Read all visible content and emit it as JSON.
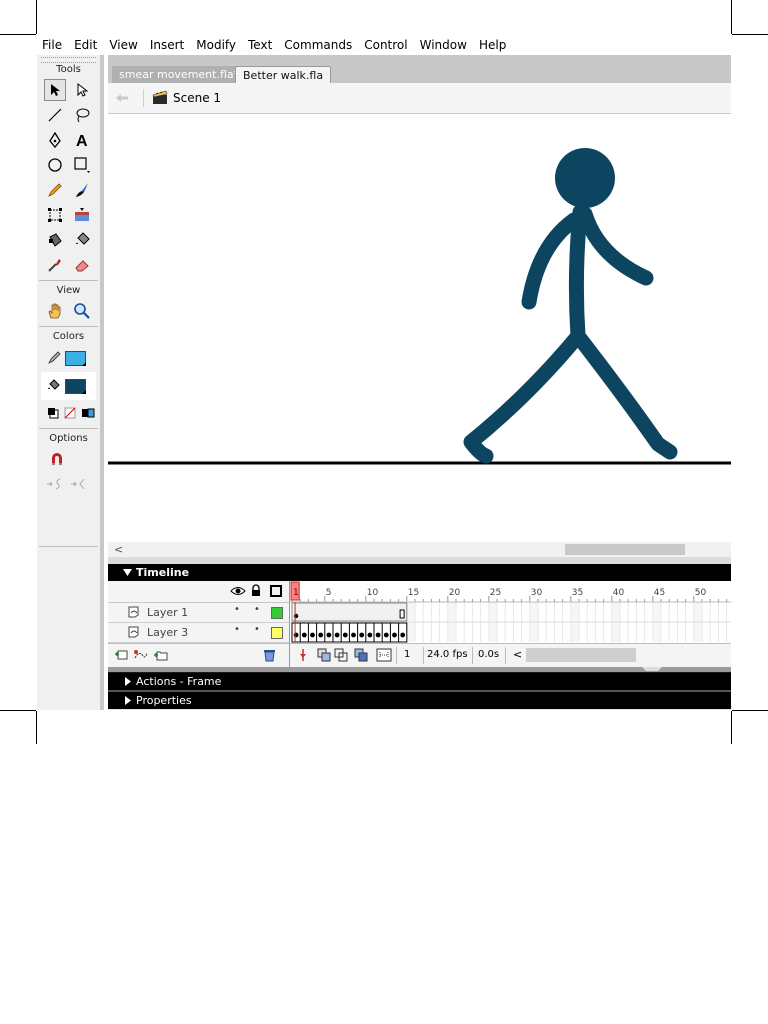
{
  "menu": [
    "File",
    "Edit",
    "View",
    "Insert",
    "Modify",
    "Text",
    "Commands",
    "Control",
    "Window",
    "Help"
  ],
  "tools": {
    "title": "Tools",
    "view_title": "View",
    "colors_title": "Colors",
    "options_title": "Options",
    "stroke_color": "#3cb0e6",
    "fill_color": "#0d4560"
  },
  "tabs": [
    "smear movement.fla*",
    "Better walk.fla"
  ],
  "editbar": {
    "scene": "Scene 1"
  },
  "stage": {
    "figure_color": "#0d4560",
    "ground_color": "#000000"
  },
  "scroll": {
    "left_arrow": "<"
  },
  "timeline": {
    "title": "Timeline",
    "ruler": [
      "1",
      "5",
      "10",
      "15",
      "20",
      "25",
      "30",
      "35",
      "40",
      "45",
      "50"
    ],
    "layers": [
      {
        "name": "Layer 1",
        "color": "#33cc33"
      },
      {
        "name": "Layer 3",
        "color": "#ffff66"
      }
    ],
    "current_frame": "1",
    "fps": "24.0 fps",
    "elapsed": "0.0s",
    "scroll_arrow": "<"
  },
  "panels": {
    "actions": "Actions - Frame",
    "properties": "Properties"
  }
}
